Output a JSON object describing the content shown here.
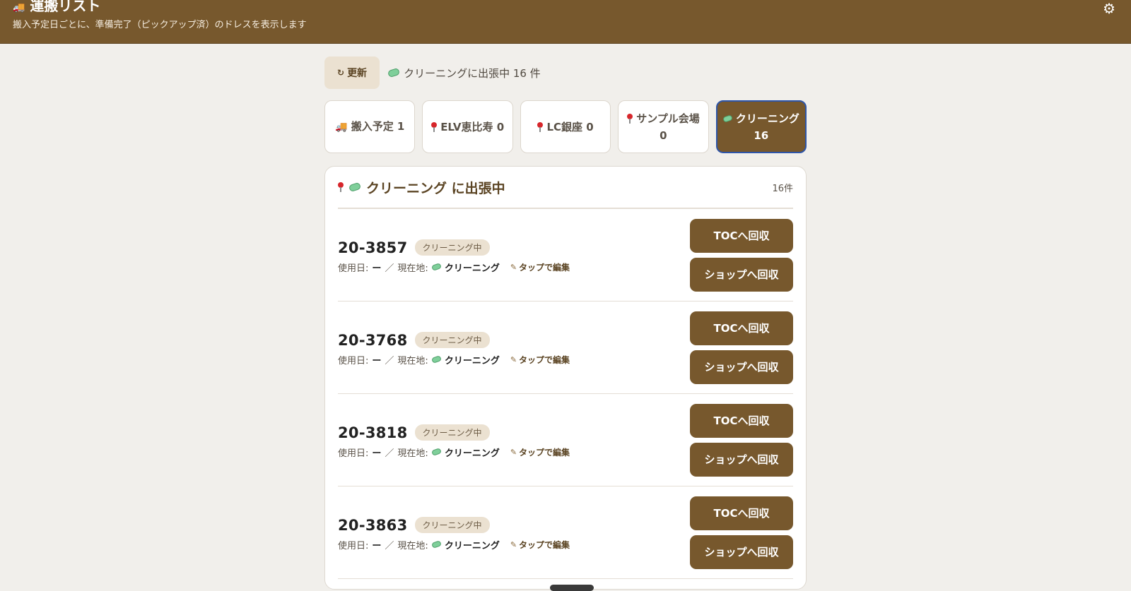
{
  "header": {
    "title": "運搬リスト",
    "subtitle": "搬入予定日ごとに、準備完了（ピックアップ済）のドレスを表示します",
    "title_icon": "truck-icon",
    "settings_icon": "gear-icon"
  },
  "toolbar": {
    "refresh_label": "更新",
    "trip_status": "クリーニングに出張中 16 件"
  },
  "tabs": [
    {
      "label": "搬入予定 1",
      "icon": "truck-icon"
    },
    {
      "label": "ELV恵比寿 0",
      "icon": "pin-icon"
    },
    {
      "label": "LC銀座 0",
      "icon": "pin-icon"
    },
    {
      "label": "サンプル会場 0",
      "icon": "pin-icon"
    },
    {
      "label": "クリーニング 16",
      "icon": "cleaning-icon",
      "active": true
    }
  ],
  "panel": {
    "title": "クリーニング に出張中",
    "count": "16件"
  },
  "rows": [
    {
      "id": "20-3857",
      "badge": "クリーニング中",
      "use_date_label": "使用日:",
      "use_date": "ー",
      "sep": "／",
      "location_label": "現在地:",
      "location": "クリーニング",
      "edit": "タップで編集",
      "btn_toc": "TOCへ回収",
      "btn_shop": "ショップへ回収"
    },
    {
      "id": "20-3768",
      "badge": "クリーニング中",
      "use_date_label": "使用日:",
      "use_date": "ー",
      "sep": "／",
      "location_label": "現在地:",
      "location": "クリーニング",
      "edit": "タップで編集",
      "btn_toc": "TOCへ回収",
      "btn_shop": "ショップへ回収"
    },
    {
      "id": "20-3818",
      "badge": "クリーニング中",
      "use_date_label": "使用日:",
      "use_date": "ー",
      "sep": "／",
      "location_label": "現在地:",
      "location": "クリーニング",
      "edit": "タップで編集",
      "btn_toc": "TOCへ回収",
      "btn_shop": "ショップへ回収"
    },
    {
      "id": "20-3863",
      "badge": "クリーニング中",
      "use_date_label": "使用日:",
      "use_date": "ー",
      "sep": "／",
      "location_label": "現在地:",
      "location": "クリーニング",
      "edit": "タップで編集",
      "btn_toc": "TOCへ回収",
      "btn_shop": "ショップへ回収"
    }
  ]
}
